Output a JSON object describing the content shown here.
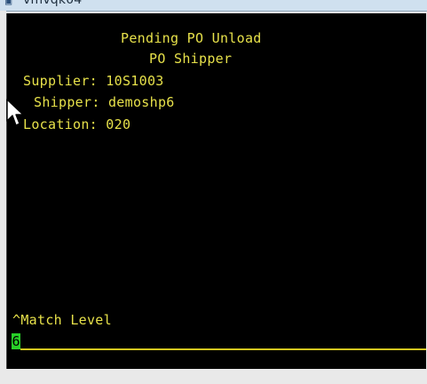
{
  "window": {
    "title": "vmvqk04",
    "icon": "terminal-app-icon"
  },
  "screen": {
    "title": "Pending PO Unload",
    "subtitle": "PO Shipper",
    "fields": {
      "supplier": "Supplier: 10S1003",
      "shipper": "Shipper: demoshp6",
      "location": "Location: 020"
    },
    "prompt_label": "^Match Level",
    "input_value": "6"
  },
  "colors": {
    "background": "#000000",
    "text": "#e7e14a",
    "cursor": "#28d028",
    "underline": "#d3c61f"
  }
}
